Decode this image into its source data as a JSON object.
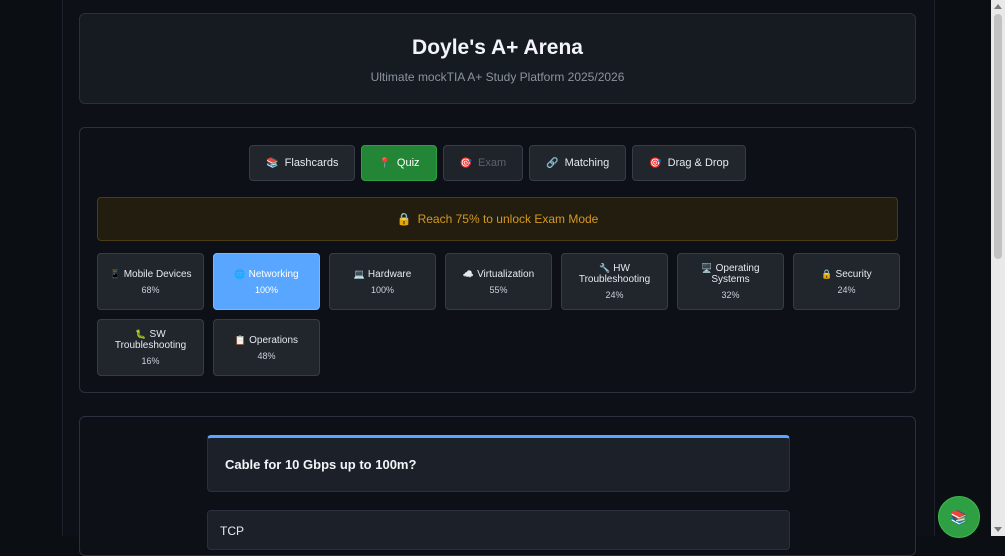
{
  "header": {
    "title": "Doyle's A+ Arena",
    "subtitle": "Ultimate mockTIA A+ Study Platform 2025/2026"
  },
  "modes": [
    {
      "icon": "cards-icon",
      "glyph": "📚",
      "label": "Flashcards",
      "state": "default"
    },
    {
      "icon": "pin-icon",
      "glyph": "📍",
      "label": "Quiz",
      "state": "active"
    },
    {
      "icon": "target-icon",
      "glyph": "🎯",
      "label": "Exam",
      "state": "disabled"
    },
    {
      "icon": "link-icon",
      "glyph": "🔗",
      "label": "Matching",
      "state": "default"
    },
    {
      "icon": "target-icon",
      "glyph": "🎯",
      "label": "Drag & Drop",
      "state": "default"
    }
  ],
  "unlock_notice": {
    "icon": "lock-icon",
    "glyph": "🔒",
    "text": "Reach 75% to unlock Exam Mode"
  },
  "topics": [
    {
      "icon": "phone-icon",
      "glyph": "📱",
      "label": "Mobile Devices",
      "percent": "68%"
    },
    {
      "icon": "globe-icon",
      "glyph": "🌐",
      "label": "Networking",
      "percent": "100%",
      "active": true
    },
    {
      "icon": "laptop-icon",
      "glyph": "💻",
      "label": "Hardware",
      "percent": "100%"
    },
    {
      "icon": "cloud-icon",
      "glyph": "☁️",
      "label": "Virtualization",
      "percent": "55%"
    },
    {
      "icon": "wrench-icon",
      "glyph": "🔧",
      "label": "HW Troubleshooting",
      "percent": "24%"
    },
    {
      "icon": "desktop-icon",
      "glyph": "🖥️",
      "label": "Operating Systems",
      "percent": "32%"
    },
    {
      "icon": "lock-icon",
      "glyph": "🔒",
      "label": "Security",
      "percent": "24%"
    },
    {
      "icon": "bug-icon",
      "glyph": "🐛",
      "label": "SW Troubleshooting",
      "percent": "16%"
    },
    {
      "icon": "clipboard-icon",
      "glyph": "📋",
      "label": "Operations",
      "percent": "48%"
    }
  ],
  "quiz": {
    "question": "Cable for 10 Gbps up to 100m?",
    "answers": [
      "TCP"
    ]
  },
  "fab": {
    "icon": "books-icon",
    "glyph": "📚"
  },
  "colors": {
    "accent": "#58a6ff",
    "active_green": "#238636",
    "warning": "#d29922",
    "background": "#0d1117"
  }
}
